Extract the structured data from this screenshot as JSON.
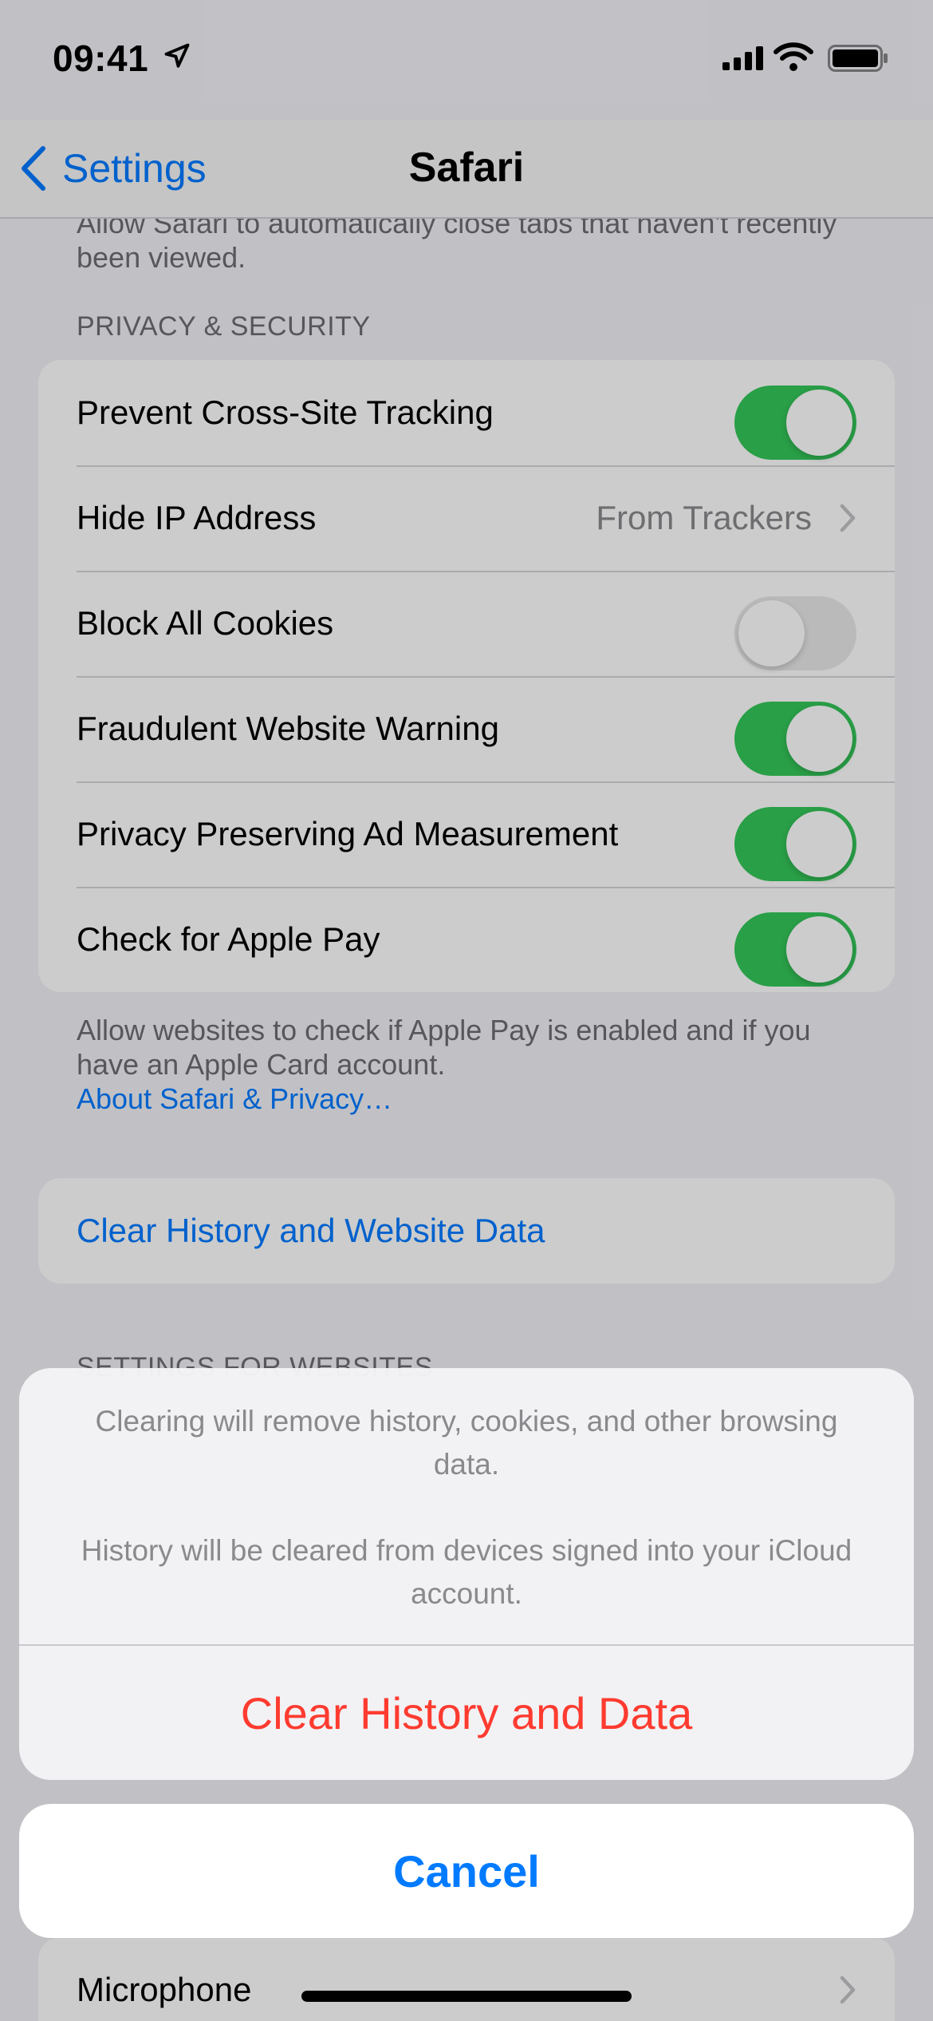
{
  "status_bar": {
    "time": "09:41"
  },
  "nav": {
    "back_label": "Settings",
    "title": "Safari"
  },
  "top_footer": "Allow Safari to automatically close tabs that haven't recently been viewed.",
  "privacy": {
    "header": "PRIVACY & SECURITY",
    "rows": {
      "cross_site": {
        "label": "Prevent Cross-Site Tracking",
        "on": true
      },
      "hide_ip": {
        "label": "Hide IP Address",
        "value": "From Trackers"
      },
      "block_cookies": {
        "label": "Block All Cookies",
        "on": false
      },
      "fraud_warning": {
        "label": "Fraudulent Website Warning",
        "on": true
      },
      "ad_measurement": {
        "label": "Privacy Preserving Ad Measurement",
        "on": true
      },
      "apple_pay": {
        "label": "Check for Apple Pay",
        "on": true
      }
    },
    "footer": "Allow websites to check if Apple Pay is enabled and if you have an Apple Card account.",
    "footer_link": "About Safari & Privacy…"
  },
  "clear_button": "Clear History and Website Data",
  "websites_header": "SETTINGS FOR WEBSITES",
  "microphone_row": "Microphone",
  "action_sheet": {
    "message_1": "Clearing will remove history, cookies, and other browsing data.",
    "message_2": "History will be cleared from devices signed into your iCloud account.",
    "destructive": "Clear History and Data",
    "cancel": "Cancel"
  },
  "colors": {
    "accent": "#007aff",
    "toggle_on": "#34c759",
    "destructive": "#ff3b30"
  }
}
